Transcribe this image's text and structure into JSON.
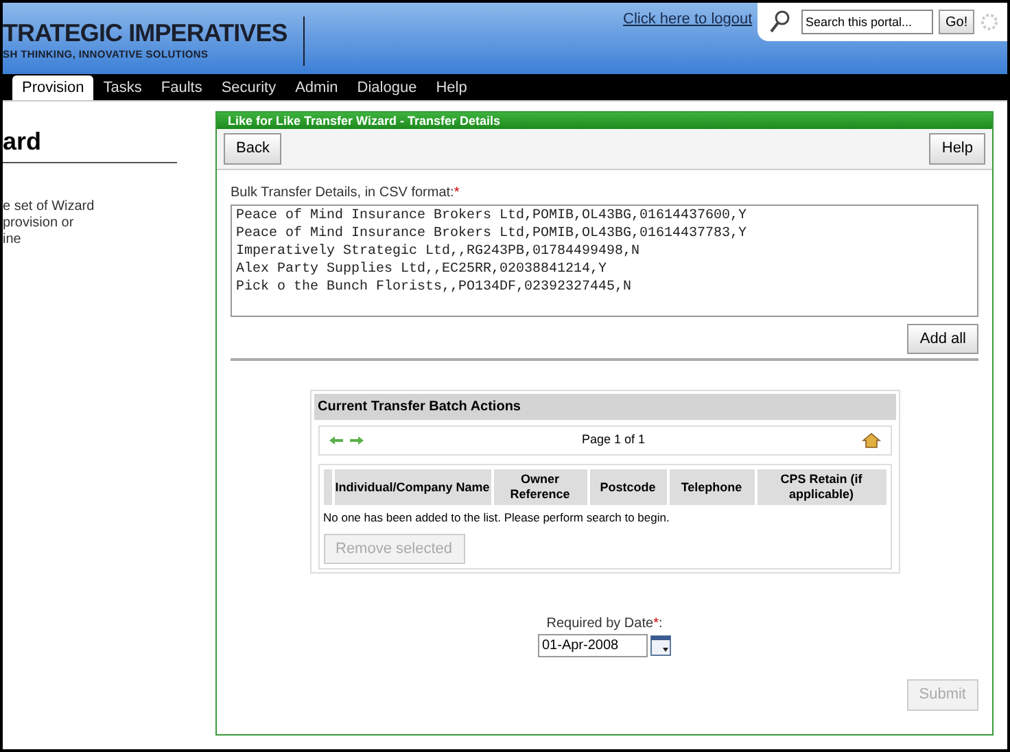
{
  "header": {
    "logo_title": "TRATEGIC IMPERATIVES",
    "logo_tagline": "SH THINKING, INNOVATIVE SOLUTIONS",
    "logout_link": "Click here to logout",
    "search": {
      "value": "Search this portal...",
      "button": "Go!"
    }
  },
  "nav": [
    {
      "label": "Provision",
      "selected": true
    },
    {
      "label": "Tasks",
      "selected": false
    },
    {
      "label": "Faults",
      "selected": false
    },
    {
      "label": "Security",
      "selected": false
    },
    {
      "label": "Admin",
      "selected": false
    },
    {
      "label": "Dialogue",
      "selected": false
    },
    {
      "label": "Help",
      "selected": false
    }
  ],
  "sidebar": {
    "heading": "ard",
    "lines": [
      "e set of Wizard",
      "provision or",
      "ine"
    ]
  },
  "wizard": {
    "title": "Like for Like Transfer Wizard - Transfer Details",
    "back_button": "Back",
    "help_button": "Help",
    "csv_label": "Bulk Transfer Details, in CSV format:",
    "csv_required_mark": "*",
    "csv_lines": [
      "Peace of Mind Insurance Brokers Ltd,POMIB,OL43BG,01614437600,Y",
      "Peace of Mind Insurance Brokers Ltd,POMIB,OL43BG,01614437783,Y",
      "Imperatively Strategic Ltd,,RG243PB,01784499498,N",
      "Alex Party Supplies Ltd,,EC25RR,02038841214,Y",
      "Pick o the Bunch Florists,,PO134DF,02392327445,N"
    ],
    "add_all_button": "Add all",
    "batch": {
      "title": "Current Transfer Batch Actions",
      "pager": "Page 1 of 1",
      "columns": [
        "Individual/Company Name",
        "Owner Reference",
        "Postcode",
        "Telephone",
        "CPS Retain (if applicable)"
      ],
      "empty_message": "No one has been added to the list. Please perform search to begin.",
      "remove_button": {
        "label": "Remove selected",
        "disabled": true
      }
    },
    "date_label": "Required by Date",
    "date_required_mark": "*",
    "date_colon": ":",
    "date_value": "01-Apr-2008",
    "submit_button": {
      "label": "Submit",
      "disabled": true
    }
  }
}
